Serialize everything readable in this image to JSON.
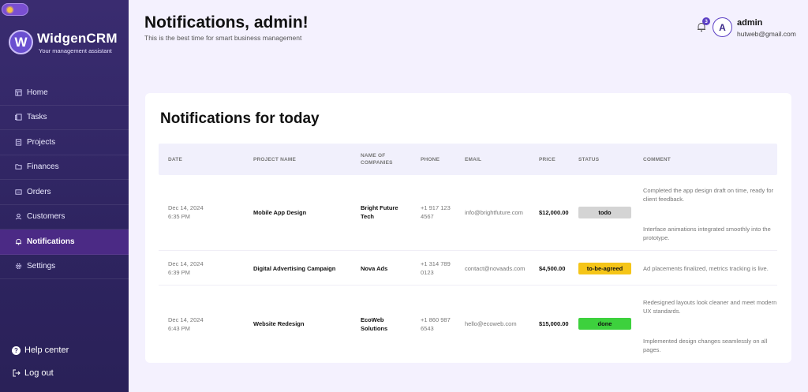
{
  "sidebar": {
    "brand": {
      "logo_letter": "W",
      "name": "WidgenCRM",
      "tagline": "Your management assistant"
    },
    "items": [
      {
        "label": "Home",
        "icon": "home-icon",
        "active": false
      },
      {
        "label": "Tasks",
        "icon": "tasks-icon",
        "active": false
      },
      {
        "label": "Projects",
        "icon": "projects-icon",
        "active": false
      },
      {
        "label": "Finances",
        "icon": "finances-icon",
        "active": false
      },
      {
        "label": "Orders",
        "icon": "orders-icon",
        "active": false
      },
      {
        "label": "Customers",
        "icon": "customers-icon",
        "active": false
      },
      {
        "label": "Notifications",
        "icon": "bell-icon",
        "active": true
      },
      {
        "label": "Settings",
        "icon": "gear-icon",
        "active": false
      }
    ],
    "help_label": "Help center",
    "logout_label": "Log out"
  },
  "header": {
    "title": "Notifications, admin!",
    "subtitle": "This is the best time for smart business management",
    "notification_count": "3",
    "user": {
      "avatar_letter": "A",
      "name": "admin",
      "email": "hutweb@gmail.com"
    }
  },
  "card": {
    "title": "Notifications for today",
    "columns": [
      "DATE",
      "PROJECT NAME",
      "NAME OF COMPANIES",
      "PHONE",
      "EMAIL",
      "PRICE",
      "STATUS",
      "COMMENT"
    ],
    "rows": [
      {
        "date": "Dec 14, 2024",
        "time": "6:35 PM",
        "project": "Mobile App Design",
        "company": "Bright Future Tech",
        "phone": "+1 917 123 4567",
        "email": "info@brightfuture.com",
        "price": "$12,000.00",
        "status": "todo",
        "comments": [
          "Completed the app design draft on time, ready for client feedback.",
          "Interface animations integrated smoothly into the prototype."
        ]
      },
      {
        "date": "Dec 14, 2024",
        "time": "6:39 PM",
        "project": "Digital Advertising Campaign",
        "company": "Nova Ads",
        "phone": "+1 314 789 0123",
        "email": "contact@novaads.com",
        "price": "$4,500.00",
        "status": "to-be-agreed",
        "comments": [
          "Ad placements finalized, metrics tracking is live."
        ]
      },
      {
        "date": "Dec 14, 2024",
        "time": "6:43 PM",
        "project": "Website Redesign",
        "company": "EcoWeb Solutions",
        "phone": "+1 860 987 6543",
        "email": "hello@ecoweb.com",
        "price": "$15,000.00",
        "status": "done",
        "comments": [
          "Redesigned layouts look cleaner and meet modern UX standards.",
          "Implemented design changes seamlessly on all pages."
        ]
      }
    ]
  },
  "colors": {
    "sidebar_bg": "#2e2460",
    "active_item": "#4b2a85",
    "status_todo": "#d4d4d4",
    "status_to_be_agreed": "#f5c518",
    "status_done": "#3dd13d"
  }
}
